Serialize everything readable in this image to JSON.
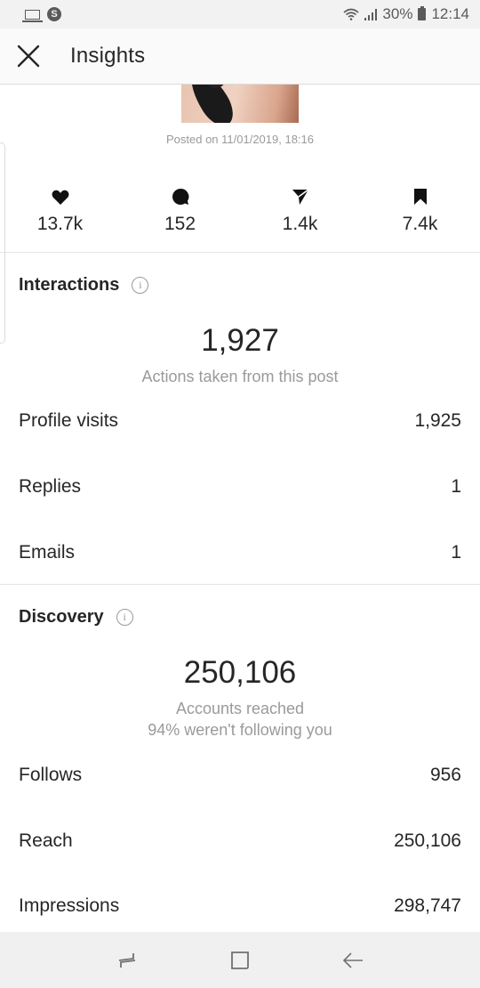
{
  "status_bar": {
    "left_icons": [
      "laptop-icon",
      "skype-icon"
    ],
    "skype_glyph": "S",
    "wifi_glyph": "☷",
    "battery_percent": "30%",
    "time": "12:14"
  },
  "app_bar": {
    "title": "Insights",
    "close_icon": "close-icon"
  },
  "post": {
    "posted_on": "Posted on 11/01/2019, 18:16"
  },
  "stats": [
    {
      "icon": "heart-icon",
      "value": "13.7k"
    },
    {
      "icon": "comment-icon",
      "value": "152"
    },
    {
      "icon": "share-icon",
      "value": "1.4k"
    },
    {
      "icon": "bookmark-icon",
      "value": "7.4k"
    }
  ],
  "interactions": {
    "title": "Interactions",
    "info_glyph": "i",
    "total": "1,927",
    "total_label": "Actions taken from this post",
    "rows": [
      {
        "label": "Profile visits",
        "value": "1,925"
      },
      {
        "label": "Replies",
        "value": "1"
      },
      {
        "label": "Emails",
        "value": "1"
      }
    ]
  },
  "discovery": {
    "title": "Discovery",
    "info_glyph": "i",
    "total": "250,106",
    "total_label": "Accounts reached",
    "total_sublabel": "94% weren't following you",
    "rows": [
      {
        "label": "Follows",
        "value": "956"
      },
      {
        "label": "Reach",
        "value": "250,106"
      },
      {
        "label": "Impressions",
        "value": "298,747"
      }
    ]
  },
  "nav_bar": {
    "buttons": [
      "recents-icon",
      "home-icon",
      "back-icon"
    ]
  }
}
